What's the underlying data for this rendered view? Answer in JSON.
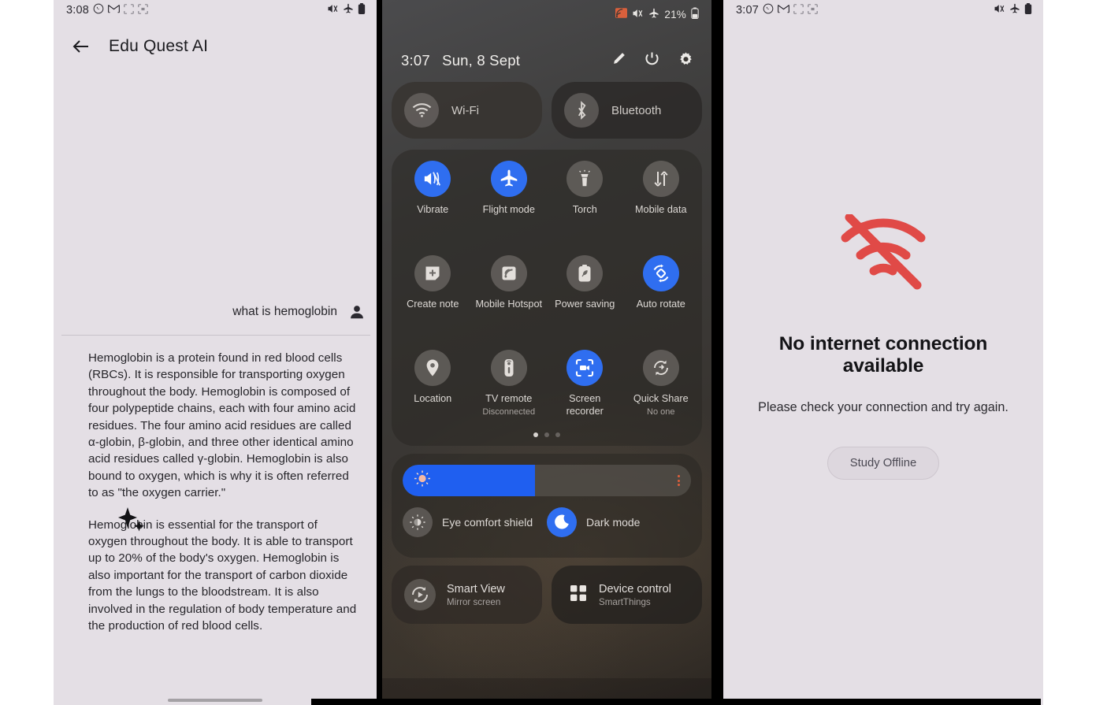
{
  "panels": {
    "chat": {
      "statusbar": {
        "time": "3:08",
        "icons": [
          "whatsapp-icon",
          "gmail-icon",
          "notification-dots-icon",
          "screenshot-icon"
        ],
        "right_icons": [
          "mute-icon",
          "airplane-mode-icon",
          "battery-icon"
        ]
      },
      "appbar": {
        "back_icon": "back-arrow-icon",
        "title": "Edu Quest AI"
      },
      "user_message": {
        "text": "what is hemoglobin",
        "avatar": "person-icon"
      },
      "ai_response": {
        "icon": "sparkle-ai-icon",
        "paragraphs": [
          "Hemoglobin is a protein found in red blood cells (RBCs). It is responsible for transporting oxygen throughout the body. Hemoglobin is composed of four polypeptide chains, each with four amino acid residues. The four amino acid residues are called α-globin, β-globin, and three other identical amino acid residues called γ-globin. Hemoglobin is also bound to oxygen, which is why it is often referred to as \"the oxygen carrier.\"",
          "Hemoglobin is essential for the transport of oxygen throughout the body. It is able to transport up to 20% of the body's oxygen. Hemoglobin is also important for the transport of carbon dioxide from the lungs to the bloodstream. It is also involved in the regulation of body temperature and the production of red blood cells."
        ]
      }
    },
    "quick_settings": {
      "statusbar": {
        "icons": [
          "screen-cast-icon",
          "mute-icon",
          "airplane-mode-icon"
        ],
        "battery_percent": "21%",
        "battery_icon": "battery-icon"
      },
      "header": {
        "time": "3:07",
        "date": "Sun, 8 Sept",
        "actions": [
          "edit-pencil-icon",
          "power-icon",
          "gear-icon"
        ]
      },
      "connectivity": [
        {
          "label": "Wi-Fi",
          "icon": "wifi-icon",
          "state": "off"
        },
        {
          "label": "Bluetooth",
          "icon": "bluetooth-icon",
          "state": "off"
        }
      ],
      "tiles": [
        {
          "label": "Vibrate",
          "icon": "vibrate-icon",
          "state": "on"
        },
        {
          "label": "Flight mode",
          "icon": "airplane-icon",
          "state": "on"
        },
        {
          "label": "Torch",
          "icon": "torch-icon",
          "state": "off"
        },
        {
          "label": "Mobile data",
          "icon": "mobile-data-icon",
          "state": "off"
        },
        {
          "label": "Create note",
          "icon": "create-note-icon",
          "state": "off"
        },
        {
          "label": "Mobile Hotspot",
          "icon": "hotspot-icon",
          "state": "off"
        },
        {
          "label": "Power saving",
          "icon": "power-saving-icon",
          "state": "off"
        },
        {
          "label": "Auto rotate",
          "icon": "auto-rotate-icon",
          "state": "on"
        },
        {
          "label": "Location",
          "icon": "location-pin-icon",
          "state": "off"
        },
        {
          "label": "TV remote",
          "sub": "Disconnected",
          "icon": "tv-remote-icon",
          "state": "off"
        },
        {
          "label": "Screen recorder",
          "icon": "screen-recorder-icon",
          "state": "on"
        },
        {
          "label": "Quick Share",
          "sub": "No one",
          "icon": "quick-share-icon",
          "state": "off"
        }
      ],
      "pagination": {
        "count": 3,
        "active": 1
      },
      "brightness": {
        "value_percent": 46,
        "knob_icon": "brightness-sun-icon",
        "menu_icon": "more-options-icon"
      },
      "display_toggles": [
        {
          "label": "Eye comfort shield",
          "icon": "eye-comfort-icon",
          "state": "off"
        },
        {
          "label": "Dark mode",
          "icon": "moon-icon",
          "state": "on"
        }
      ],
      "bottom_cards": [
        {
          "title": "Smart View",
          "sub": "Mirror screen",
          "icon": "smart-view-icon"
        },
        {
          "title": "Device control",
          "sub": "SmartThings",
          "icon": "device-control-icon"
        }
      ]
    },
    "offline": {
      "statusbar": {
        "time": "3:07",
        "icons": [
          "whatsapp-icon",
          "gmail-icon",
          "notification-dots-icon",
          "screenshot-icon"
        ],
        "right_icons": [
          "mute-icon",
          "airplane-mode-icon",
          "battery-icon"
        ]
      },
      "icon": "wifi-off-icon",
      "title": "No internet connection available",
      "subtitle": "Please check your connection and try again.",
      "button_label": "Study Offline"
    }
  },
  "colors": {
    "chat_bg": "#e4dfe5",
    "accent_blue": "#2f6ef0",
    "error_red": "#e04a47",
    "qs_text": "#e9e7e4"
  }
}
